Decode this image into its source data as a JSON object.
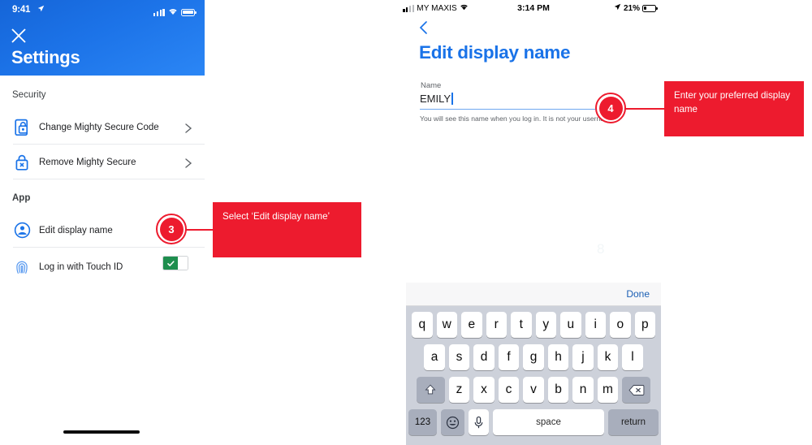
{
  "theme": {
    "brand_blue": "#1a73e8",
    "header_blue": "#1c73e8",
    "callout_red": "#ed1b2e",
    "toggle_green": "#1e8e4e",
    "keyboard_bg": "#cdd1da"
  },
  "left_phone": {
    "status_bar": {
      "time": "9:41",
      "location_icon": "location-arrow-icon",
      "signal_icon": "cellular-signal-icon",
      "wifi_icon": "wifi-icon",
      "battery_icon": "battery-full-icon"
    },
    "close_icon": "close-icon",
    "title": "Settings",
    "sections": [
      {
        "label": "Security",
        "rows": [
          {
            "icon": "document-lock-icon",
            "label": "Change Mighty Secure Code",
            "accessory": "chevron-right-icon"
          },
          {
            "icon": "lock-x-icon",
            "label": "Remove Mighty Secure",
            "accessory": "chevron-right-icon"
          }
        ]
      },
      {
        "label": "App",
        "rows": [
          {
            "icon": "user-avatar-icon",
            "label": "Edit display name",
            "accessory": "none"
          },
          {
            "icon": "fingerprint-icon",
            "label": "Log in with Touch ID",
            "accessory": "toggle-on"
          }
        ]
      }
    ],
    "home_indicator": "home-indicator"
  },
  "callouts": [
    {
      "number": "3",
      "text": "Select ‘Edit display name’"
    },
    {
      "number": "4",
      "text": "Enter your preferred display name"
    }
  ],
  "right_phone": {
    "status_bar": {
      "carrier": "MY MAXIS",
      "time": "3:14 PM",
      "battery_percent": "21%",
      "signal_icon": "cellular-signal-icon",
      "wifi_icon": "wifi-icon",
      "location_icon": "location-arrow-icon",
      "battery_icon": "battery-low-icon"
    },
    "back_icon": "chevron-left-icon",
    "title": "Edit display name",
    "form": {
      "field_label": "Name",
      "field_value": "EMILY",
      "help_text": "You will see this name when you log in. It is not your username."
    },
    "watermark": "8"
  },
  "keyboard": {
    "toolbar": {
      "done_label": "Done"
    },
    "row1": [
      "q",
      "w",
      "e",
      "r",
      "t",
      "y",
      "u",
      "i",
      "o",
      "p"
    ],
    "row2": [
      "a",
      "s",
      "d",
      "f",
      "g",
      "h",
      "j",
      "k",
      "l"
    ],
    "row3_letters": [
      "z",
      "x",
      "c",
      "v",
      "b",
      "n",
      "m"
    ],
    "shift_icon": "shift-up-icon",
    "backspace_icon": "backspace-delete-icon",
    "numbers_label": "123",
    "emoji_icon": "smiley-emoji-icon",
    "mic_icon": "microphone-icon",
    "space_label": "space",
    "return_label": "return"
  }
}
